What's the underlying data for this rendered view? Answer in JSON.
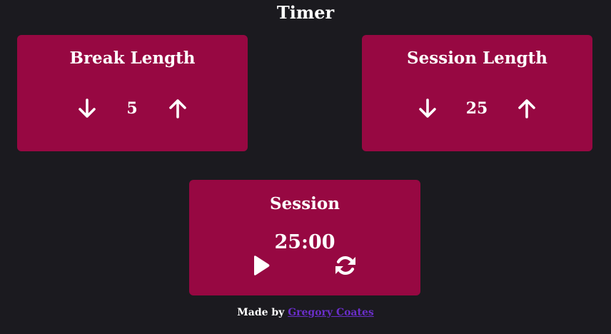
{
  "page": {
    "title": "Timer",
    "background": "#1b1a1f",
    "card_color": "#970842",
    "link_color": "#6a2ec9"
  },
  "break": {
    "label": "Break Length",
    "value": "5",
    "decrement_icon": "arrow-down-icon",
    "increment_icon": "arrow-up-icon"
  },
  "session": {
    "label": "Session Length",
    "value": "25",
    "decrement_icon": "arrow-down-icon",
    "increment_icon": "arrow-up-icon"
  },
  "timer": {
    "label": "Session",
    "time_left": "25:00",
    "play_icon": "play-icon",
    "reset_icon": "refresh-icon"
  },
  "footer": {
    "prefix": "Made by",
    "author": "Gregory Coates"
  }
}
